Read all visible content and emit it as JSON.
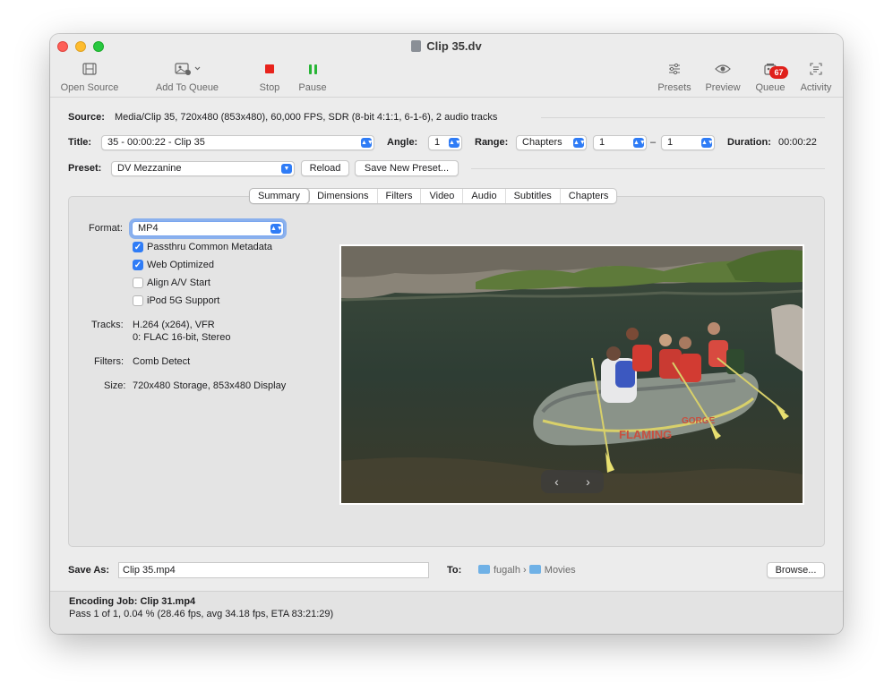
{
  "window": {
    "title": "Clip 35.dv"
  },
  "toolbar": {
    "open_source": "Open Source",
    "add_to_queue": "Add To Queue",
    "stop": "Stop",
    "pause": "Pause",
    "presets": "Presets",
    "preview": "Preview",
    "queue": "Queue",
    "queue_badge": "67",
    "activity": "Activity"
  },
  "source": {
    "label": "Source:",
    "value": "Media/Clip 35, 720x480 (853x480), 60,000 FPS, SDR (8-bit 4:1:1, 6-1-6), 2 audio tracks"
  },
  "title_row": {
    "title_label": "Title:",
    "title_value": "35 - 00:00:22 - Clip 35",
    "angle_label": "Angle:",
    "angle_value": "1",
    "range_label": "Range:",
    "range_value": "Chapters",
    "range_start": "1",
    "range_dash": "–",
    "range_end": "1",
    "duration_label": "Duration:",
    "duration_value": "00:00:22"
  },
  "preset_row": {
    "label": "Preset:",
    "value": "DV Mezzanine",
    "reload": "Reload",
    "save_new": "Save New Preset..."
  },
  "tabs": [
    "Summary",
    "Dimensions",
    "Filters",
    "Video",
    "Audio",
    "Subtitles",
    "Chapters"
  ],
  "summary": {
    "format_label": "Format:",
    "format_value": "MP4",
    "checkboxes": [
      {
        "label": "Passthru Common Metadata",
        "checked": true
      },
      {
        "label": "Web Optimized",
        "checked": true
      },
      {
        "label": "Align A/V Start",
        "checked": false
      },
      {
        "label": "iPod 5G Support",
        "checked": false
      }
    ],
    "tracks_label": "Tracks:",
    "tracks_line1": "H.264 (x264), VFR",
    "tracks_line2": "0: FLAC 16-bit, Stereo",
    "filters_label": "Filters:",
    "filters_value": "Comb Detect",
    "size_label": "Size:",
    "size_value": "720x480 Storage, 853x480 Display"
  },
  "preview_nav": {
    "prev": "‹",
    "next": "›"
  },
  "save": {
    "label": "Save As:",
    "value": "Clip 35.mp4",
    "to_label": "To:",
    "path_user": "fugalh",
    "path_sep": "›",
    "path_folder": "Movies",
    "browse": "Browse..."
  },
  "status": {
    "job": "Encoding Job: Clip 31.mp4",
    "progress": "Pass 1 of 1, 0.04 % (28.46 fps, avg 34.18 fps, ETA 83:21:29)"
  },
  "colors": {
    "accent": "#2f7cf6",
    "stop": "#e8231c",
    "pause": "#27b535",
    "badge": "#e0201b"
  }
}
